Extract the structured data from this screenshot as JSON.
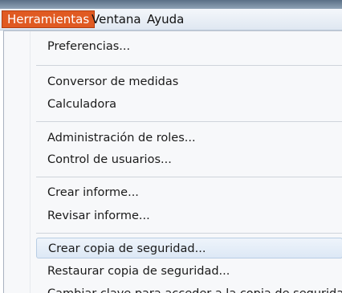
{
  "menubar": {
    "items": [
      {
        "label": "Herramientas",
        "active": true
      },
      {
        "label": "Ventana",
        "active": false
      },
      {
        "label": "Ayuda",
        "active": false
      }
    ]
  },
  "menu": {
    "items": [
      {
        "label": "Preferencias..."
      },
      {
        "label": "Conversor de medidas"
      },
      {
        "label": "Calculadora"
      },
      {
        "label": "Administración de roles..."
      },
      {
        "label": "Control de usuarios..."
      },
      {
        "label": "Crear informe..."
      },
      {
        "label": "Revisar informe..."
      },
      {
        "label": "Crear copia de seguridad..."
      },
      {
        "label": "Restaurar copia de seguridad..."
      },
      {
        "label": "Cambiar clave para acceder a la copia de seguridad..."
      }
    ],
    "highlighted_item": "Crear copia de seguridad..."
  },
  "colors": {
    "active_menu": "#e05a22",
    "highlight": "#dde8f5"
  }
}
